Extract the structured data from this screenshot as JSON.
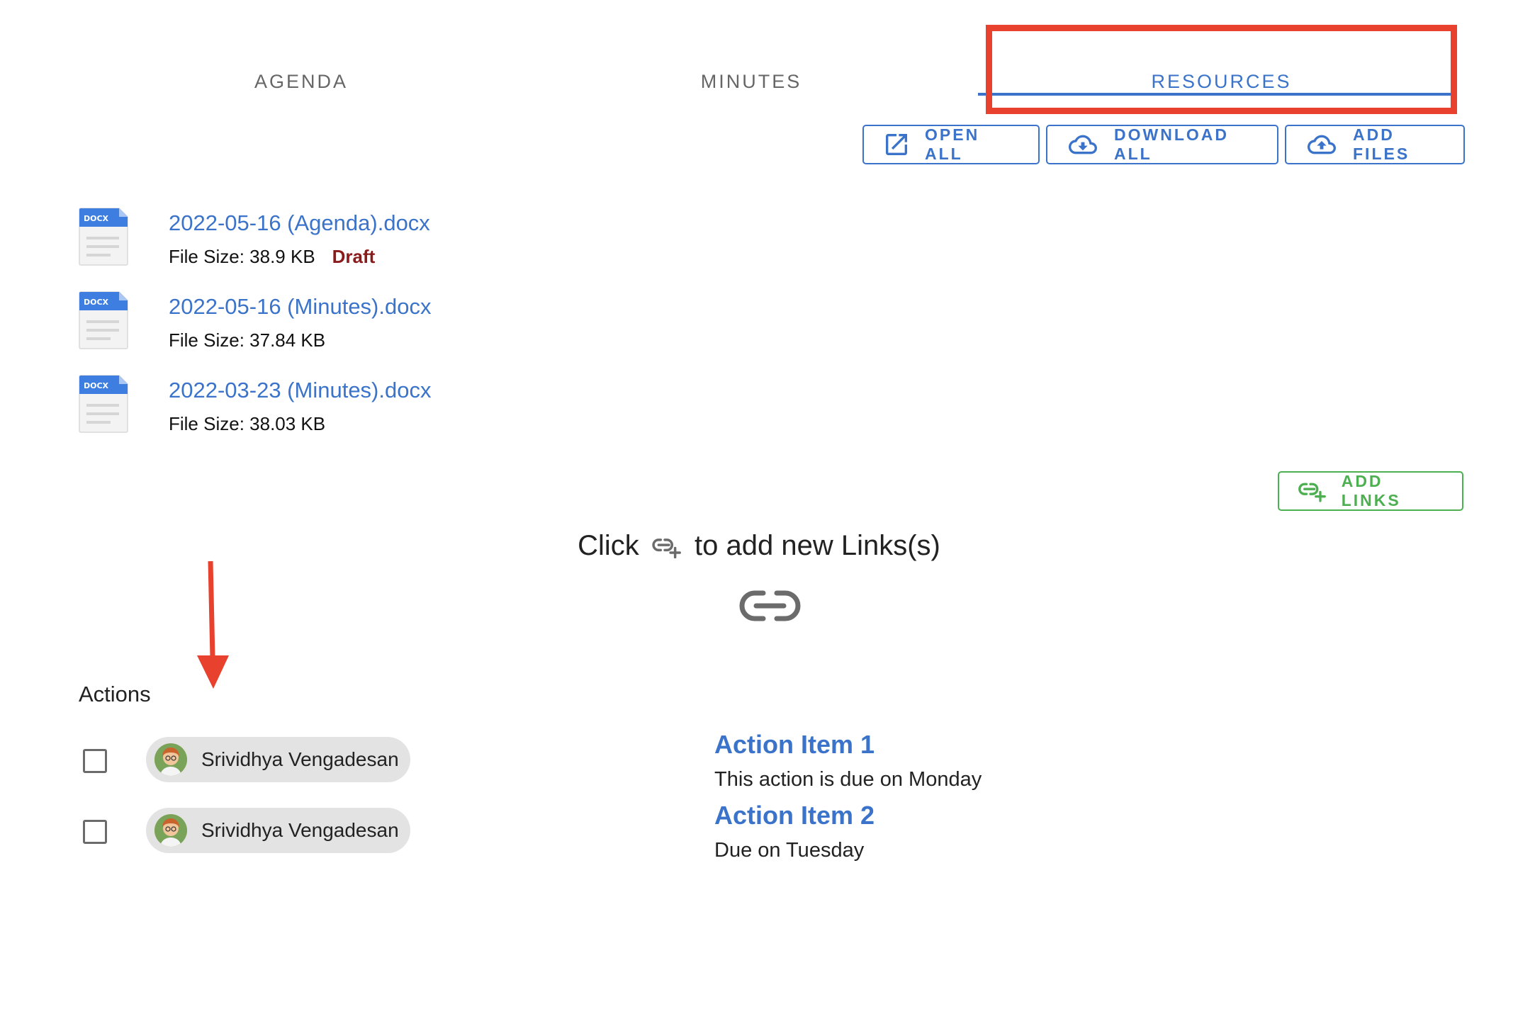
{
  "tabs": [
    {
      "label": "AGENDA",
      "active": false
    },
    {
      "label": "MINUTES",
      "active": false
    },
    {
      "label": "RESOURCES",
      "active": true
    }
  ],
  "toolbar": {
    "open_all": "OPEN ALL",
    "download_all": "DOWNLOAD ALL",
    "add_files": "ADD FILES"
  },
  "files": [
    {
      "icon_text": "DOCX",
      "name": "2022-05-16 (Agenda).docx",
      "size": "File Size: 38.9 KB",
      "status": "Draft"
    },
    {
      "icon_text": "DOCX",
      "name": "2022-05-16 (Minutes).docx",
      "size": "File Size: 37.84 KB",
      "status": ""
    },
    {
      "icon_text": "DOCX",
      "name": "2022-03-23 (Minutes).docx",
      "size": "File Size: 38.03 KB",
      "status": ""
    }
  ],
  "links": {
    "add_links": "ADD LINKS",
    "hint_before": "Click",
    "hint_after": "to add new Links(s)"
  },
  "actions": {
    "title": "Actions",
    "assignees": [
      {
        "name": "Srividhya Vengadesan",
        "checked": false
      },
      {
        "name": "Srividhya Vengadesan",
        "checked": false
      }
    ],
    "items": [
      {
        "title": "Action Item 1",
        "description": "This action is due on Monday"
      },
      {
        "title": "Action Item 2",
        "description": "Due on Tuesday"
      }
    ]
  },
  "colors": {
    "primary": "#3a73c9",
    "success": "#4caf50",
    "draft": "#8b1a1a",
    "annotation": "#e8412e"
  }
}
